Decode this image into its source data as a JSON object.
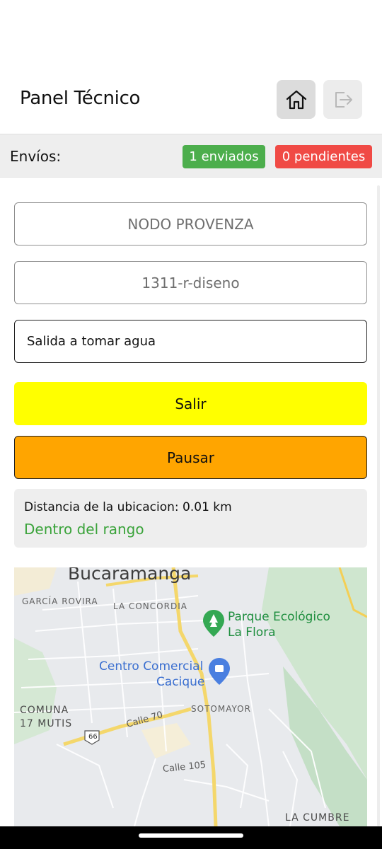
{
  "header": {
    "title": "Panel Técnico",
    "home_icon": "home-icon",
    "logout_icon": "logout-icon"
  },
  "envios": {
    "label": "Envíos:",
    "sent": "1 enviados",
    "pending": "0 pendientes",
    "colors": {
      "sent": "#4cae4c",
      "pending": "#f04a45"
    }
  },
  "form": {
    "node": "NODO PROVENZA",
    "code": "1311-r-diseno",
    "reason": "Salida a tomar agua"
  },
  "actions": {
    "exit_label": "Salir",
    "pause_label": "Pausar",
    "colors": {
      "exit": "#ffff00",
      "pause": "#ffa500"
    }
  },
  "distance": {
    "text": "Distancia de la ubicacion: 0.01 km",
    "status": "Dentro del rango",
    "status_color": "#3aa33a"
  },
  "map": {
    "labels": {
      "city": "Bucaramanga",
      "garcia": "GARCÍA ROVIRA",
      "concordia": "LA CONCORDIA",
      "park_line1": "Parque Ecológico",
      "park_line2": "La Flora",
      "mall_line1": "Centro Comercial",
      "mall_line2": "Cacique",
      "comuna_line1": "COMUNA",
      "comuna_line2": "17 MUTIS",
      "sotomayor": "SOTOMAYOR",
      "calle70": "Calle 70",
      "route66": "66",
      "calle105": "Calle 105",
      "cumbre": "LA CUMBRE"
    },
    "icons": [
      "tree-pin-icon",
      "shopping-pin-icon",
      "route-shield-icon"
    ]
  }
}
